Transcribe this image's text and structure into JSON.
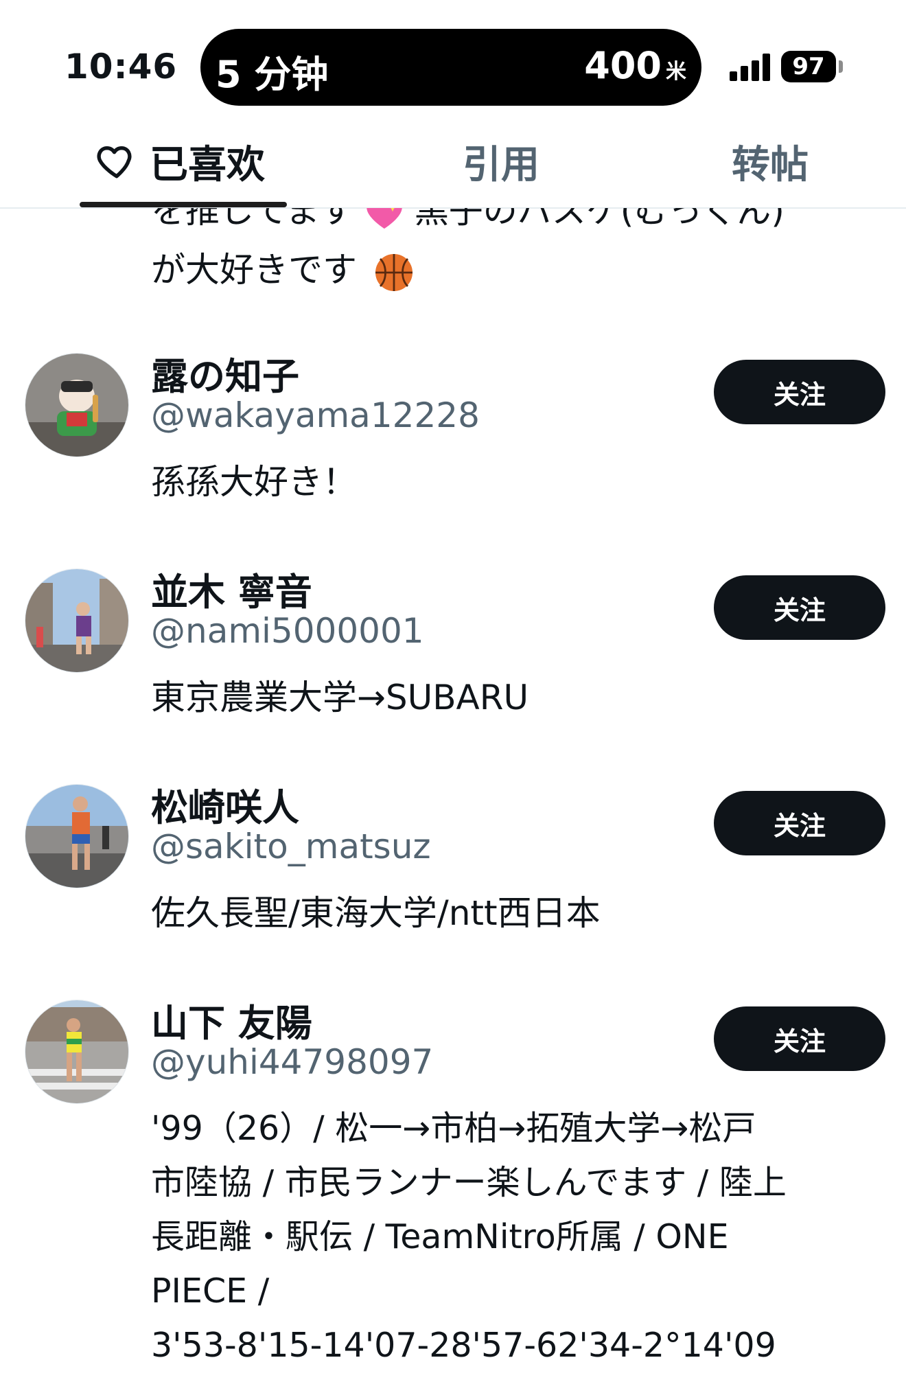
{
  "status_bar": {
    "time": "10:46",
    "activity_left": "5 分钟",
    "activity_right": "400",
    "activity_unit": "米",
    "battery": "97"
  },
  "tabs": [
    {
      "label": "已喜欢",
      "active": true
    },
    {
      "label": "引用",
      "active": false
    },
    {
      "label": "转帖",
      "active": false
    }
  ],
  "clipped_bio": {
    "line1": "を推してます",
    "line1_tail": "黒子のバスケ(むっくん)",
    "line2": "が大好きです"
  },
  "users": [
    {
      "name": "露の知子",
      "handle": "@wakayama12228",
      "bio": "孫孫大好き！",
      "follow_label": "关注"
    },
    {
      "name": "並木 寧音",
      "handle": "@nami5000001",
      "bio": "東京農業大学→SUBARU",
      "follow_label": "关注"
    },
    {
      "name": "松崎咲人",
      "handle": "@sakito_matsuz",
      "bio": "佐久長聖/東海大学/ntt西日本",
      "follow_label": "关注"
    },
    {
      "name": "山下 友陽",
      "handle": "@yuhi44798097",
      "bio_lines": [
        "'99（26）/ 松一→市柏→拓殖大学→松戸",
        "市陸協 / 市民ランナー楽しんでます / 陸上",
        "長距離・駅伝 / TeamNitro所属 / ONE",
        "PIECE /",
        "3'53-8'15-14'07-28'57-62'34-2°14'09"
      ],
      "follow_label": "关注"
    }
  ],
  "colors": {
    "text_primary": "#0f1419",
    "text_secondary": "#536471",
    "button_bg": "#0f1419",
    "divider": "#e6ecf0"
  }
}
